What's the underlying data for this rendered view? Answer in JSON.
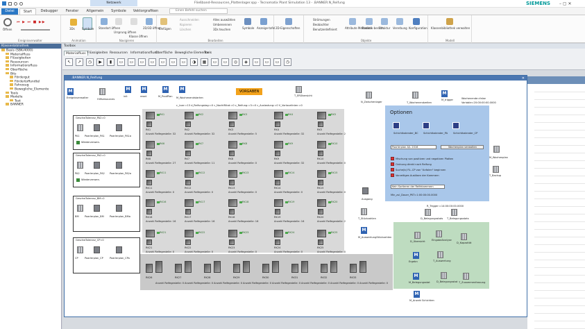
{
  "app": {
    "title": "Fließband-Ressourcen_Plattenlager.spp - Tecnomatix Plant Simulation 13 - .BANNER.N_Reifung",
    "search_placeholder": "Einen Befehl suchen",
    "context_tab": "Netzwerk",
    "brand": "SIEMENS"
  },
  "tabs": [
    "Datei",
    "Start",
    "Debugger",
    "Fenster",
    "Allgemein",
    "Symbole",
    "Vektorgrafiken"
  ],
  "ribbon": {
    "groups": [
      {
        "label": "Ereignisverwalter",
        "items": [
          "Öffnen"
        ]
      },
      {
        "label": "Animation",
        "items": [
          "3Ds",
          "Symbole"
        ]
      },
      {
        "label": "Navigieren",
        "items": [
          "Standort öffnen",
          "Ursprung öffnen",
          "Klasse öffnen",
          "2D/3D öffnen"
        ]
      },
      {
        "label": "Bearbeiten",
        "items": [
          "Einfügen",
          "Ausschneiden",
          "Kopieren",
          "Löschen",
          "Alles auswählen",
          "Umbenennen",
          "3Ds teuchen",
          "Symbole",
          "Anzeige-tafel"
        ]
      },
      {
        "label": "",
        "items": [
          "2D-Eigenschaften"
        ]
      },
      {
        "label": "Objekte",
        "items": [
          "Strömungen",
          "Beobachter",
          "Benutzerdefiniert",
          "Attribute Methoden",
          "Statistik-bericht",
          "Struktur",
          "Vererbung",
          "Konfiguration"
        ]
      },
      {
        "label": "Modell",
        "items": [
          "Klassenbibliothek verwalten"
        ]
      }
    ]
  },
  "left_panel": {
    "title": "Klassenbibliothek",
    "tree": [
      {
        "label": "Basis (SBK/4000)",
        "level": 0
      },
      {
        "label": "Materialfluss",
        "level": 1
      },
      {
        "label": "Flüssigkeiten",
        "level": 1
      },
      {
        "label": "Ressourcen",
        "level": 1
      },
      {
        "label": "Informationsfluss",
        "level": 1
      },
      {
        "label": "Oberfläche",
        "level": 1
      },
      {
        "label": "Bits",
        "level": 1
      },
      {
        "label": "Fördergut",
        "level": 2
      },
      {
        "label": "Fördertoffundtel",
        "level": 2
      },
      {
        "label": "Fahrzeug",
        "level": 2
      },
      {
        "label": "Bewegliche_Elemente",
        "level": 2
      },
      {
        "label": "Tools",
        "level": 1
      },
      {
        "label": "Modelle",
        "level": 1
      },
      {
        "label": "Test",
        "level": 2
      },
      {
        "label": "BANNER",
        "level": 1
      }
    ]
  },
  "toolbox": {
    "title": "Toolbox",
    "tabs": [
      "Materialfluss",
      "Flüssigkeiten",
      "Ressourcen",
      "Informationsfluss",
      "Oberfläche",
      "Bewegliche Elemente",
      "Tools"
    ],
    "icons": [
      "pointer-icon",
      "connector-icon",
      "event-icon",
      "source-icon",
      "drain-icon",
      "single-proc-icon",
      "parallel-proc-icon",
      "assembly-icon",
      "dismantle-icon",
      "shift-icon",
      "line-icon",
      "angle-icon",
      "turntable-icon",
      "store-icon",
      "buffer-icon",
      "sorter-icon",
      "cycle-icon",
      "flow-icon",
      "track-icon",
      "transfer-icon",
      "dismantle2-icon",
      "cycle2-icon"
    ]
  },
  "frame": {
    "title": ".BANNER.N_Reifung",
    "top_icons": [
      "Ereignisverwalter",
      "Hilfsresources",
      "init",
      "reset",
      "M_ProdPlan",
      "M_Wochenendstarten",
      "T_ERÜbersicht",
      "N_Zwischenlager",
      "T_Wochenendzeiten",
      "M_trigger"
    ],
    "vorgaben": "VORGABEN",
    "counters": "c_Lsar:=13   d_Reifungstag:=0   c_NochtRitat:=0   c_Reifung:=3:=0   c_Auslastung:=0   V_Vorlauelinien:=0",
    "weekend": [
      "Wochenende=false",
      "Variable=20:00:00:00.0000"
    ],
    "left_groups": [
      {
        "title": "GeschwToleranz_PA2=0",
        "a": "PA1",
        "b": "Paarlerplan_PA1",
        "c": "Paarlerplan_PA1a",
        "check": "Wiederverwen."
      },
      {
        "title": "GeschwToleranz_PA2=0",
        "a": "PA2",
        "b": "Paarlerplan_PA2",
        "c": "Paarlerplan_PA2a",
        "check": "Wiederverwen."
      },
      {
        "title": "GeschwToleranz_BM=0",
        "a": "BM",
        "b": "Paarlerplan_BM",
        "c": "Paarlerplan_BMa",
        "check": ""
      },
      {
        "title": "GeschwToleranz_CP=0",
        "a": "CP",
        "b": "Paarlerplan_CP",
        "c": "Paarlerplan_CPa",
        "check": ""
      }
    ],
    "rack_cells": [
      {
        "n": "RK1",
        "c": "Anzahl Reifegestelle: 32"
      },
      {
        "n": "RK2",
        "c": "Anzahl Reifegestelle: 32"
      },
      {
        "n": "RK3",
        "c": "Anzahl Reifegestelle: 5"
      },
      {
        "n": "RK4",
        "c": "Anzahl Reifegestelle: 32"
      },
      {
        "n": "RK5",
        "c": "Anzahl Reifegestelle: 2"
      },
      {
        "n": "RK6",
        "c": "Anzahl Reifegestelle: 27"
      },
      {
        "n": "RK7",
        "c": "Anzahl Reifegestelle: 11"
      },
      {
        "n": "RK8",
        "c": "Anzahl Reifegestelle: 0"
      },
      {
        "n": "RK9",
        "c": "Anzahl Reifegestelle: 32"
      },
      {
        "n": "RK10",
        "c": "Anzahl Reifegestelle: 0"
      },
      {
        "n": "RK11",
        "c": "Anzahl Reifegestelle: 0"
      },
      {
        "n": "RK12",
        "c": "Anzahl Reifegestelle: 0"
      },
      {
        "n": "RK13",
        "c": "Anzahl Reifegestelle: 0"
      },
      {
        "n": "RK14",
        "c": "Anzahl Reifegestelle: 0"
      },
      {
        "n": "RK15",
        "c": "Anzahl Reifegestelle: 0"
      },
      {
        "n": "RK16",
        "c": "Anzahl Reifegestelle: 16"
      },
      {
        "n": "RK17",
        "c": "Anzahl Reifegestelle: 16"
      },
      {
        "n": "RK18",
        "c": "Anzahl Reifegestelle: 16"
      },
      {
        "n": "RK19",
        "c": "Anzahl Reifegestelle: 16"
      },
      {
        "n": "RK20",
        "c": "Anzahl Reifegestelle: 2"
      },
      {
        "n": "RK21",
        "c": "Anzahl Reifegestelle: 0"
      },
      {
        "n": "RK22",
        "c": "Anzahl Reifegestelle: 0"
      },
      {
        "n": "RK23",
        "c": "Anzahl Reifegestelle: 0"
      },
      {
        "n": "RK24",
        "c": "Anzahl Reifegestelle: 0"
      },
      {
        "n": "RK25",
        "c": "Anzahl Reifegestelle: 0"
      }
    ],
    "bottom_racks": [
      "RK26",
      "RK27",
      "RK28",
      "RK29",
      "RK30",
      "RK31",
      "RK32",
      "RK33"
    ],
    "bottom_caption": "Anzahl Reifegestelle: 0",
    "mid_labels": [
      "Ausgang",
      "T_Stückzahlen",
      "M_AuswertungStückzahlen"
    ],
    "options": {
      "title": "Optionen",
      "items": [
        "Schichtkalender_BC",
        "Schichtkalender_PA",
        "Schichtkalender_CP"
      ],
      "select1": "Paarlerplan A/L 2016",
      "button1": "Wochenplan verwalten",
      "checks": [
        "Mischung von positiven und negativen Platten",
        "Ordnung direkt nach Reifung",
        "Suche(b) Fü.-CP von \"Anfalen\" beginnen",
        "Vorzeitiges Auslösen der Kammern"
      ],
      "select2": "Kein Sortieren der Reifekammern",
      "mindauer": "Min_zul_Dauer_PKT=1:00:00:00.0000"
    },
    "right_icons": [
      "M_Wochenplan",
      "T_Backup"
    ],
    "trigger": "R_Trigger:=14:00:00:00.0000",
    "green": {
      "items": [
        "D_Belegungsstats",
        "T_Belegungsstats",
        "D_Übersicht",
        "EingabeAnalyse",
        "D_Kapazität",
        "Ergebn",
        "T_Auswertung",
        "M_Belegungsstat",
        "D_Belegungsstat",
        "T_Zusammenfassung",
        "M_Anzahl Schichten"
      ]
    }
  },
  "colors": {
    "ribbon_accent": "#2b78c5",
    "frame_title": "#4b77b1",
    "options_bg": "#a9c7ea",
    "green_bg": "#bedcc0",
    "vorgaben_bg": "#f3a21b",
    "rack_green": "#4aa84a"
  }
}
